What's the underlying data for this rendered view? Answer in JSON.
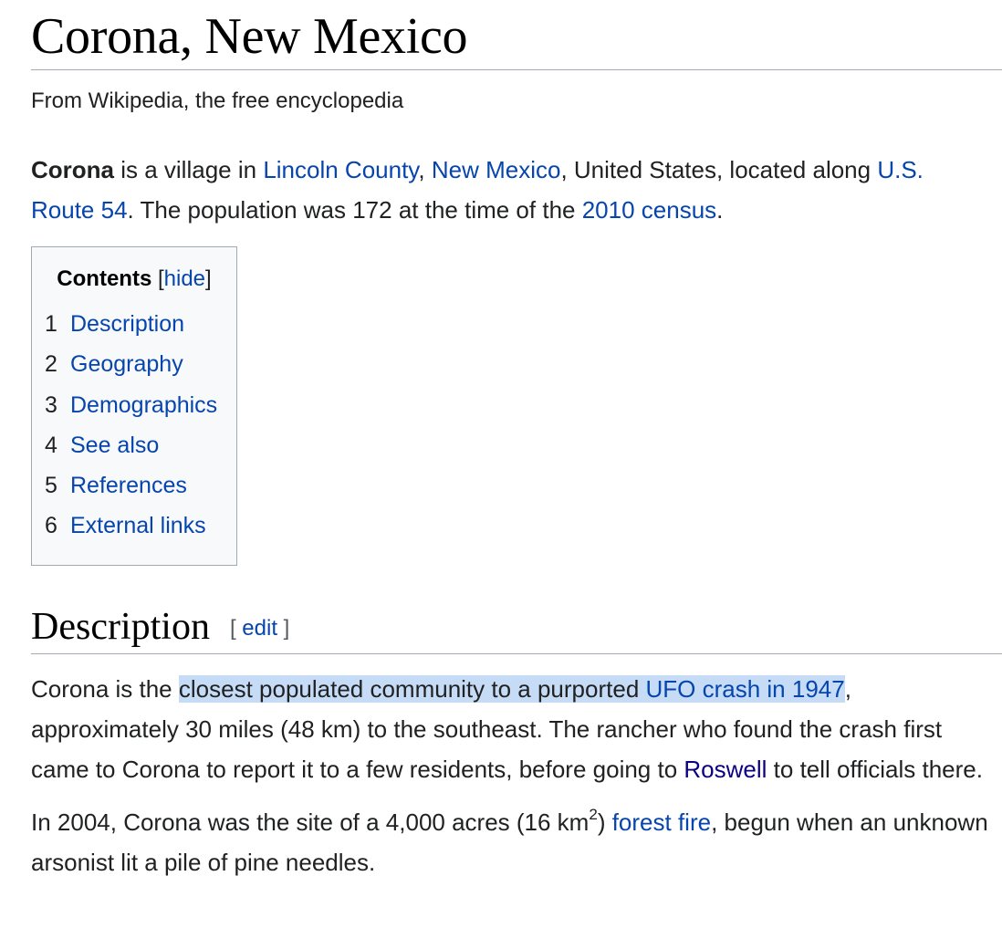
{
  "article": {
    "title": "Corona, New Mexico",
    "tagline": "From Wikipedia, the free encyclopedia"
  },
  "lead": {
    "bold": "Corona",
    "t1": " is a village in ",
    "link_county": "Lincoln County",
    "t2": ", ",
    "link_state": "New Mexico",
    "t3": ", United States, located along ",
    "link_route": "U.S. Route 54",
    "t4": ". The population was 172 at the time of the ",
    "link_census": "2010 census",
    "t5": "."
  },
  "toc": {
    "title": "Contents",
    "bracket_open": " [",
    "hide_label": "hide",
    "bracket_close": "]",
    "items": [
      {
        "num": "1",
        "label": "Description"
      },
      {
        "num": "2",
        "label": "Geography"
      },
      {
        "num": "3",
        "label": "Demographics"
      },
      {
        "num": "4",
        "label": "See also"
      },
      {
        "num": "5",
        "label": "References"
      },
      {
        "num": "6",
        "label": "External links"
      }
    ]
  },
  "description": {
    "heading": "Description",
    "edit_open": "[ ",
    "edit_label": "edit",
    "edit_close": " ]",
    "p1": {
      "t1": "Corona is the ",
      "highlight_text": "closest populated community to a purported ",
      "link_ufo": "UFO crash in 1947",
      "t2": ", approximately 30 miles (48 km) to the southeast. The rancher who found the crash first came to Corona to report it to a few residents, before going to ",
      "link_roswell": "Roswell",
      "t3": " to tell officials there."
    },
    "p2": {
      "t1": "In 2004, Corona was the site of a 4,000 acres (16 km",
      "sup": "2",
      "t2": ") ",
      "link_fire": "forest fire",
      "t3": ", begun when an unknown arsonist lit a pile of pine needles."
    }
  },
  "colors": {
    "link": "#0645ad",
    "visited_link": "#0b0080",
    "highlight": "#c6dcf6",
    "border": "#a2a9b1"
  }
}
